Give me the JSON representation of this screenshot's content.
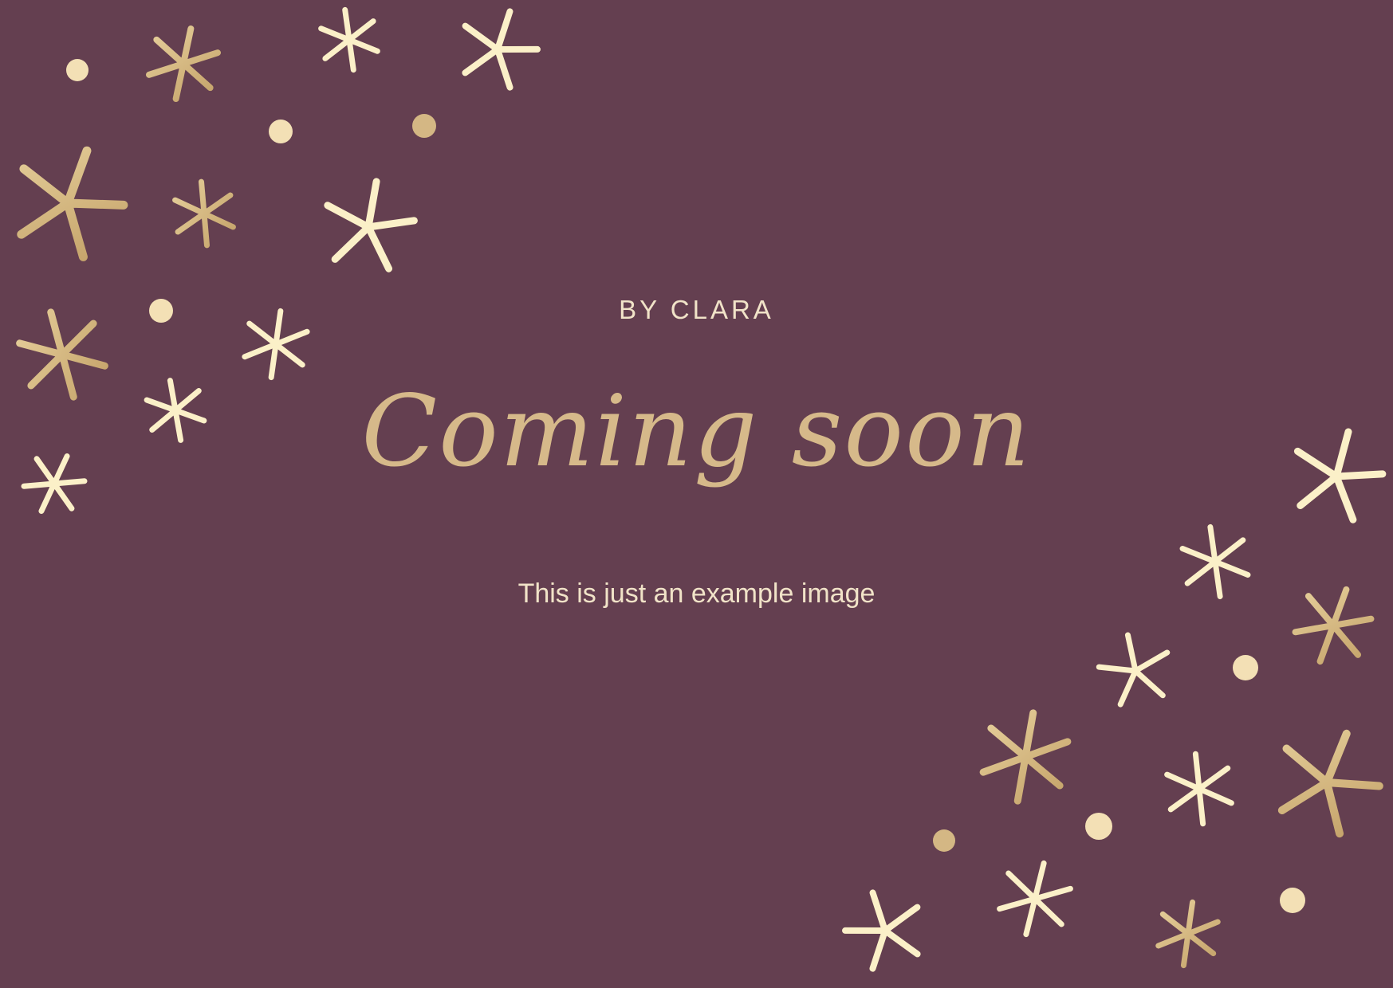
{
  "byline": "BY CLARA",
  "title": "Coming soon",
  "subtitle": "This is just an example image",
  "colors": {
    "background": "#643f50",
    "gold": "#d6b98a",
    "cream": "#fbf0c8",
    "text_light": "#f1e3c8"
  },
  "decorations": {
    "star_icon": "sparkle-star-icon",
    "dot_icon": "doodle-dot-icon"
  }
}
